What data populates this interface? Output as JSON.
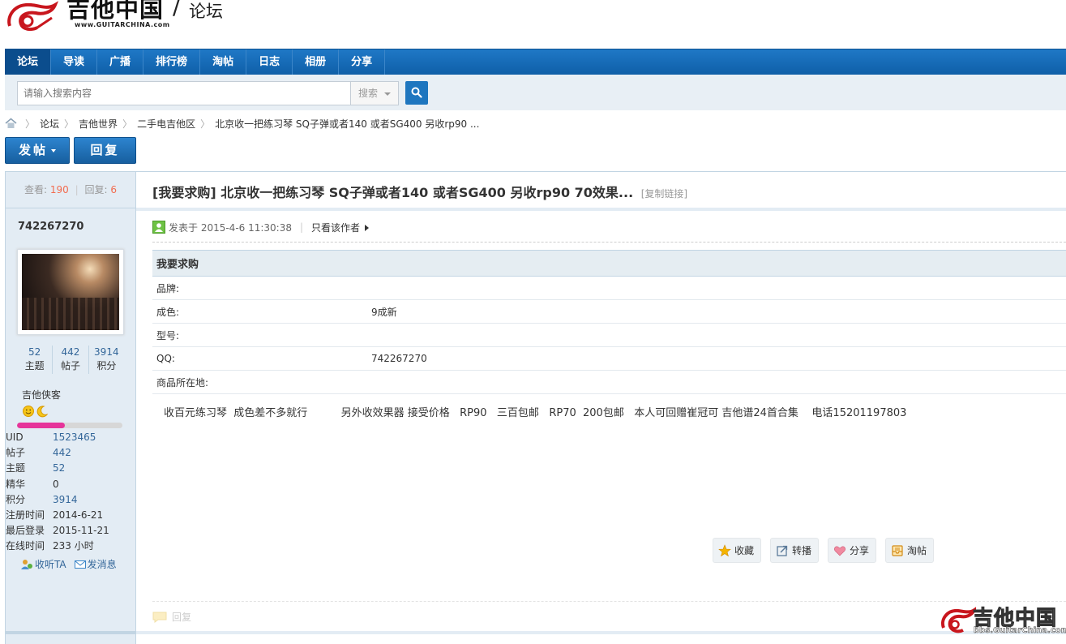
{
  "logo": {
    "brand": "吉他中国",
    "slash": "/",
    "sub": "论坛",
    "url": "www.GUITARCHINA.com"
  },
  "nav": {
    "items": [
      "论坛",
      "导读",
      "广播",
      "排行榜",
      "淘帖",
      "日志",
      "相册",
      "分享"
    ]
  },
  "search": {
    "placeholder": "请输入搜索内容",
    "type_label": "搜索"
  },
  "breadcrumb": [
    "论坛",
    "吉他世界",
    "二手电吉他区",
    "北京收一把练习琴 SQ子弹或者140 或者SG400 另收rp90 ..."
  ],
  "actions": {
    "post_label": "发帖",
    "reply_label": "回复"
  },
  "thread": {
    "views_label": "查看:",
    "views": "190",
    "replies_label": "回复:",
    "replies": "6",
    "title": "[我要求购] 北京收一把练习琴 SQ子弹或者140 或者SG400 另收rp90 70效果...",
    "copy_link": "[复制链接]"
  },
  "author": {
    "name": "742267270",
    "counts": [
      {
        "num": "52",
        "label": "主题"
      },
      {
        "num": "442",
        "label": "帖子"
      },
      {
        "num": "3914",
        "label": "积分"
      }
    ],
    "usergroup": "吉他侠客",
    "level_progress": 0.45,
    "profile": [
      {
        "k": "UID",
        "v": "1523465",
        "link": true
      },
      {
        "k": "帖子",
        "v": "442",
        "link": true
      },
      {
        "k": "主题",
        "v": "52",
        "link": true
      },
      {
        "k": "精华",
        "v": "0",
        "link": false
      },
      {
        "k": "积分",
        "v": "3914",
        "link": true
      },
      {
        "k": "注册时间",
        "v": "2014-6-21",
        "link": false
      },
      {
        "k": "最后登录",
        "v": "2015-11-21",
        "link": false
      },
      {
        "k": "在线时间",
        "v": "233 小时",
        "link": false
      }
    ],
    "follow_label": "收听TA",
    "message_label": "发消息"
  },
  "post": {
    "posted_at": "发表于 2015-4-6 11:30:38",
    "author_only": "只看该作者",
    "table_head": "我要求购",
    "fields": [
      {
        "k": "品牌:",
        "v": ""
      },
      {
        "k": "成色:",
        "v": "9成新"
      },
      {
        "k": "型号:",
        "v": ""
      },
      {
        "k": "QQ:",
        "v": "742267270"
      },
      {
        "k": "商品所在地:",
        "v": ""
      }
    ],
    "body": "收百元练习琴  成色差不多就行          另外收效果器 接受价格   RP90   三百包邮   RP70  200包邮   本人可回赠崔冠可 吉他谱24首合集    电话15201197803",
    "buttons": [
      {
        "label": "收藏",
        "icon": "star-icon"
      },
      {
        "label": "转播",
        "icon": "share-edit-icon"
      },
      {
        "label": "分享",
        "icon": "heart-icon"
      },
      {
        "label": "淘帖",
        "icon": "tray-icon"
      }
    ],
    "reply_label": "回复"
  },
  "watermark": {
    "title": "吉他中国",
    "url": "bbs.GuitarChina.com"
  },
  "colors": {
    "nav_blue": "#1a6dba",
    "accent_orange": "#f26c4f",
    "link_blue": "#336699",
    "progress_pink": "#e6349a"
  }
}
